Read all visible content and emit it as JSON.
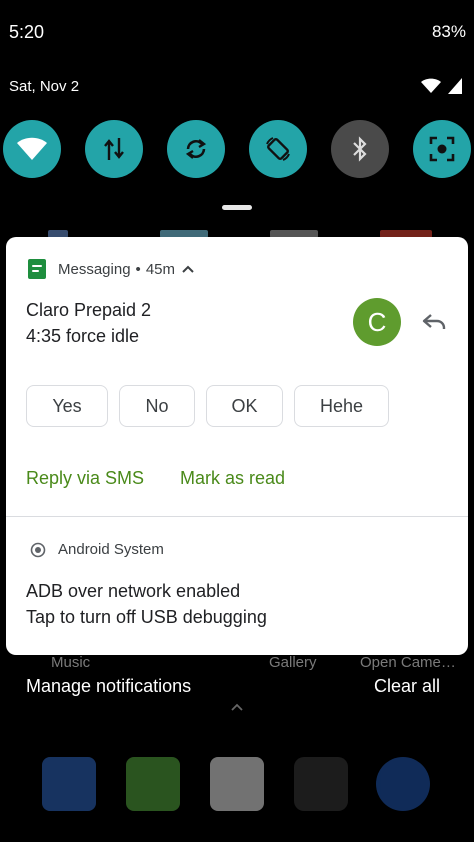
{
  "status_bar": {
    "time": "5:20",
    "battery": "83%"
  },
  "quick_settings": {
    "date": "Sat, Nov 2",
    "tiles": [
      {
        "name": "wifi",
        "icon": "wifi-icon",
        "state": "on"
      },
      {
        "name": "mobile-data",
        "icon": "data-arrows-icon",
        "state": "on"
      },
      {
        "name": "auto-sync",
        "icon": "sync-icon",
        "state": "on"
      },
      {
        "name": "auto-rotate",
        "icon": "rotate-icon",
        "state": "on"
      },
      {
        "name": "bluetooth",
        "icon": "bluetooth-icon",
        "state": "off"
      },
      {
        "name": "screenshot",
        "icon": "screenshot-icon",
        "state": "on"
      }
    ]
  },
  "notifications": {
    "messaging": {
      "app_name": "Messaging",
      "separator": "•",
      "time": "45m",
      "sender": "Claro Prepaid 2",
      "message": "4:35 force idle",
      "avatar_letter": "C",
      "smart_replies": [
        "Yes",
        "No",
        "OK",
        "Hehe"
      ],
      "actions": [
        "Reply via SMS",
        "Mark as read"
      ]
    },
    "system": {
      "app_name": "Android System",
      "title": "ADB over network enabled",
      "body": "Tap to turn off USB debugging"
    }
  },
  "behind_labels": [
    "Music",
    "Gallery",
    "Open Came…"
  ],
  "footer": {
    "manage": "Manage notifications",
    "clear": "Clear all"
  },
  "colors": {
    "tile_on": "#23a4a8",
    "tile_off": "#4a4a4a",
    "avatar": "#5f9c2e",
    "action_text": "#4a8a1a",
    "messaging_icon": "#1e8e3e"
  }
}
